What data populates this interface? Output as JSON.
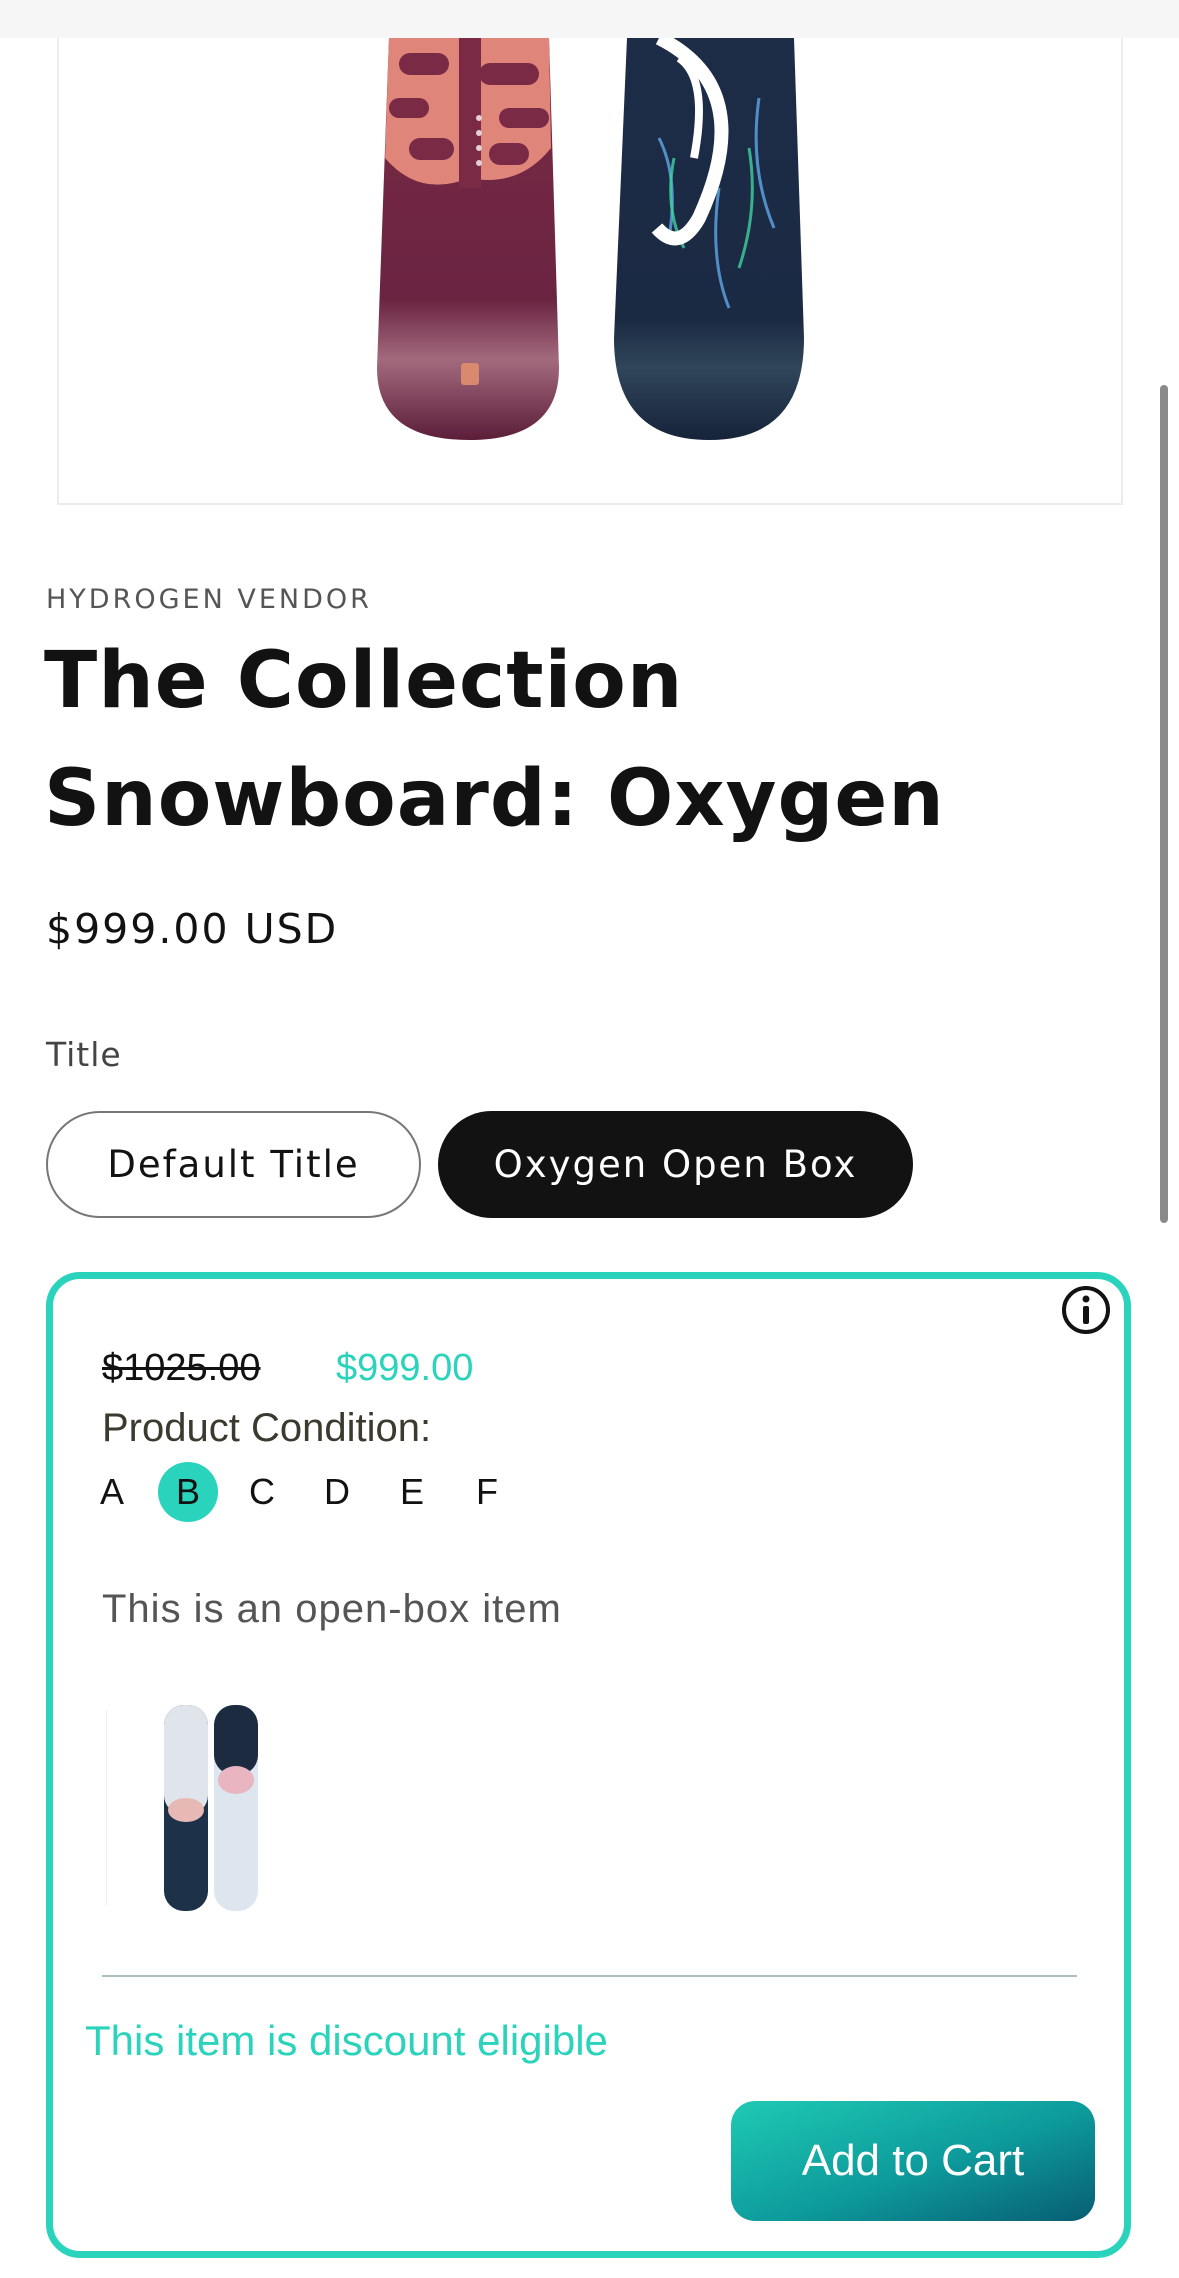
{
  "product": {
    "vendor": "HYDROGEN VENDOR",
    "title": "The Collection Snowboard: Oxygen",
    "price": "$999.00 USD"
  },
  "options": {
    "label": "Title",
    "values": [
      "Default Title",
      "Oxygen Open Box"
    ],
    "selected": "Oxygen Open Box"
  },
  "open_box": {
    "original_price": "$1025.00",
    "sale_price": "$999.00",
    "condition_label": "Product Condition:",
    "grades": [
      "A",
      "B",
      "C",
      "D",
      "E",
      "F"
    ],
    "selected_grade": "B",
    "description": "This is an open-box item",
    "discount_note": "This item is discount eligible",
    "add_to_cart": "Add to Cart",
    "info_icon": "info-icon"
  },
  "colors": {
    "accent": "#2ad3bb",
    "button_dark": "#121212",
    "cart_gradient_start": "#1fcab4",
    "cart_gradient_end": "#085d73"
  }
}
